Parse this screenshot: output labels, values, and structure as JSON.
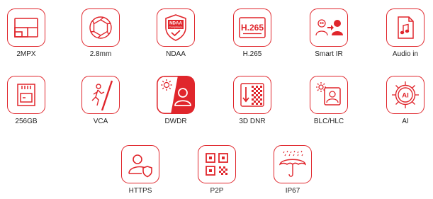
{
  "accent_color": "#e0262c",
  "features": [
    {
      "label": "2MPX",
      "icon": "resolution-icon"
    },
    {
      "label": "2.8mm",
      "icon": "lens-aperture-icon"
    },
    {
      "label": "NDAA",
      "icon": "ndaa-compliance-shield-icon",
      "badge_line1": "NDAA",
      "badge_line2": "Compliance"
    },
    {
      "label": "H.265",
      "icon": "h265-codec-icon",
      "badge_text": "H.265"
    },
    {
      "label": "Smart IR",
      "icon": "smart-ir-icon"
    },
    {
      "label": "Audio in",
      "icon": "audio-file-icon"
    },
    {
      "label": "256GB",
      "icon": "sd-card-icon"
    },
    {
      "label": "VCA",
      "icon": "intrusion-detection-icon"
    },
    {
      "label": "DWDR",
      "icon": "dwdr-icon"
    },
    {
      "label": "3D DNR",
      "icon": "noise-reduction-icon"
    },
    {
      "label": "BLC/HLC",
      "icon": "backlight-compensation-icon"
    },
    {
      "label": "AI",
      "icon": "ai-chip-icon",
      "badge_text": "AI"
    },
    {
      "label": "HTTPS",
      "icon": "secure-user-icon"
    },
    {
      "label": "P2P",
      "icon": "qr-code-icon"
    },
    {
      "label": "IP67",
      "icon": "weatherproof-umbrella-icon"
    }
  ]
}
